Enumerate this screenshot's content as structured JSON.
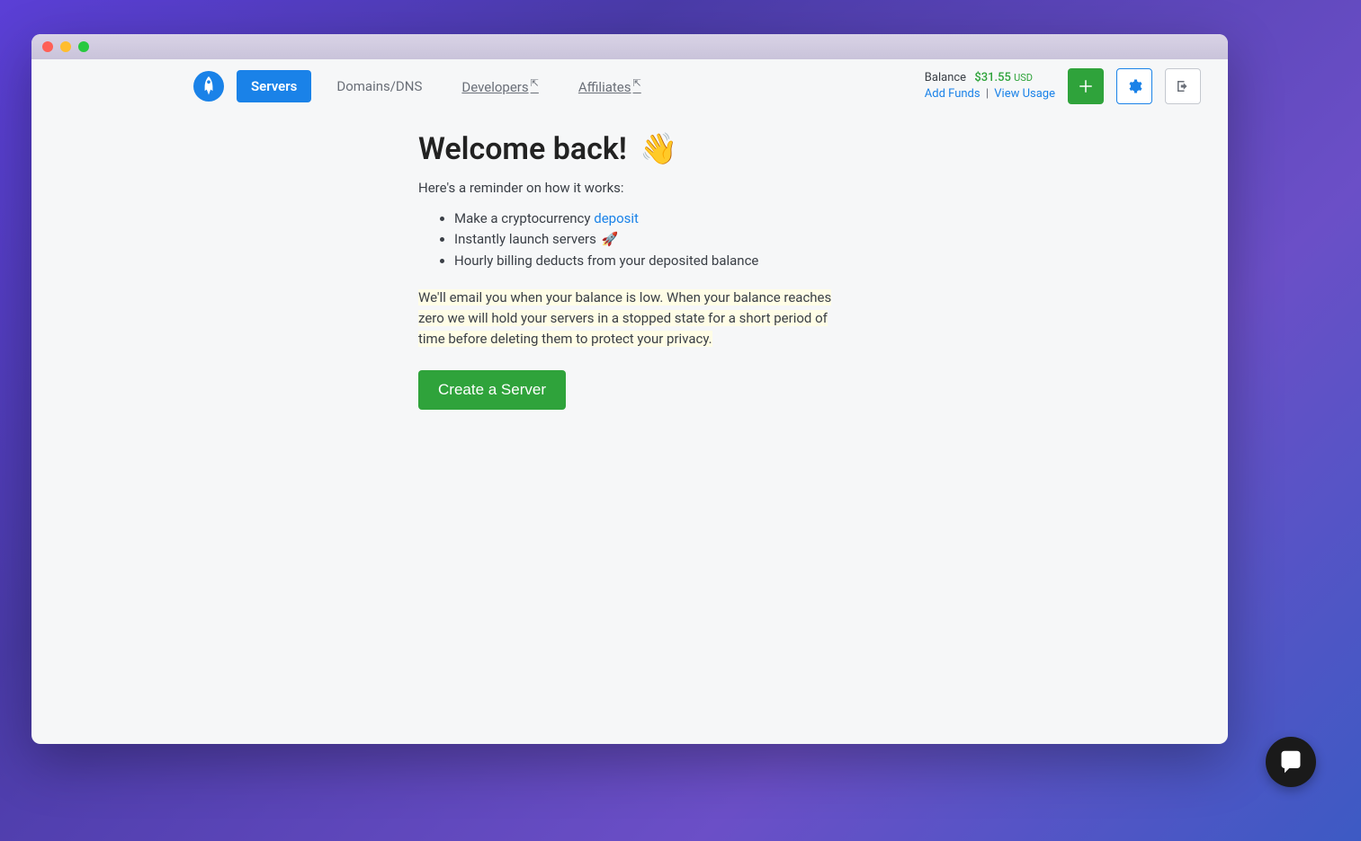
{
  "nav": {
    "servers": "Servers",
    "domains": "Domains/DNS",
    "developers": "Developers",
    "affiliates": "Affiliates"
  },
  "balance": {
    "label": "Balance",
    "amount": "$31.55",
    "currency": "USD",
    "add_funds": "Add Funds",
    "view_usage": "View Usage",
    "sep": "|"
  },
  "main": {
    "heading": "Welcome back!",
    "wave_emoji": "👋",
    "subtitle": "Here's a reminder on how it works:",
    "step1_prefix": "Make a cryptocurrency ",
    "step1_link": "deposit",
    "step2": "Instantly launch servers",
    "rocket_emoji": "🚀",
    "step3": "Hourly billing deducts from your deposited balance",
    "warn1": " We'll email you when your balance is low.",
    "warn2": " When your balance reaches zero we will hold your servers in a stopped state for a short period of time before deleting them to protect your privacy.",
    "create_button": "Create a Server"
  }
}
